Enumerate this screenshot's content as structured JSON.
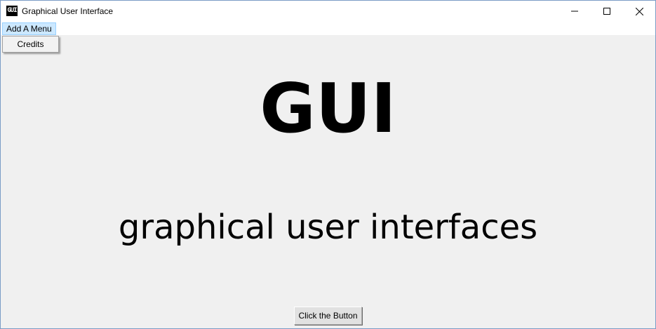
{
  "window": {
    "title": "Graphical User Interface",
    "icon_text": "GUI",
    "icon_name": "app-icon",
    "controls": [
      "minimize-icon",
      "maximize-icon",
      "close-icon"
    ]
  },
  "menubar": {
    "items": [
      {
        "label": "Add A Menu",
        "state": "open"
      }
    ]
  },
  "dropdown": {
    "items": [
      {
        "label": "Credits"
      }
    ]
  },
  "content": {
    "heading": "GUI",
    "subheading": "graphical user interfaces",
    "button_label": "Click the Button"
  },
  "colors": {
    "background": "#f0f0f0",
    "titlebar": "#ffffff",
    "menu_highlight": "#cce8ff",
    "text": "#000000"
  }
}
